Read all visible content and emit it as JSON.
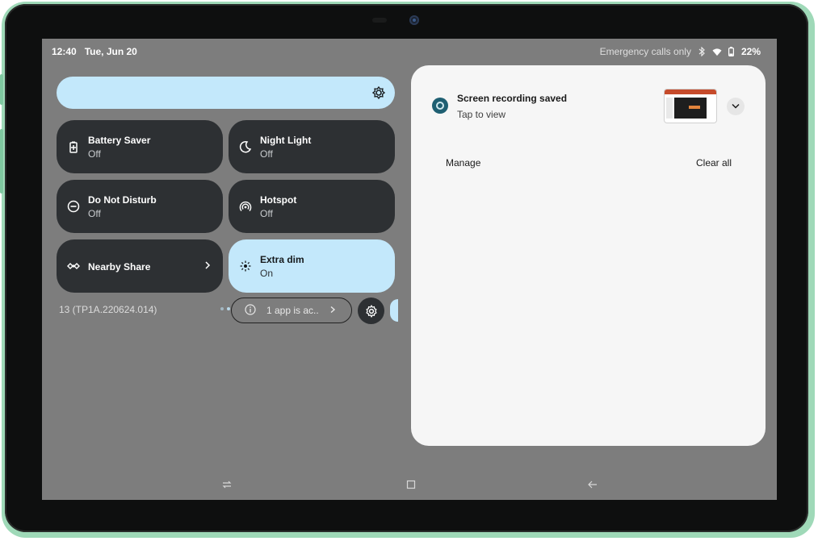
{
  "status_bar": {
    "time": "12:40",
    "date": "Tue, Jun 20",
    "carrier_text": "Emergency calls only",
    "battery": "22%"
  },
  "quick_settings": {
    "tiles": [
      {
        "title": "Battery Saver",
        "state": "Off",
        "icon": "battery-saver-icon",
        "active": false
      },
      {
        "title": "Night Light",
        "state": "Off",
        "icon": "night-light-icon",
        "active": false
      },
      {
        "title": "Do Not Disturb",
        "state": "Off",
        "icon": "do-not-disturb-icon",
        "active": false
      },
      {
        "title": "Hotspot",
        "state": "Off",
        "icon": "hotspot-icon",
        "active": false
      },
      {
        "title": "Nearby Share",
        "state": "",
        "icon": "nearby-share-icon",
        "active": false
      },
      {
        "title": "Extra dim",
        "state": "On",
        "icon": "extra-dim-icon",
        "active": true
      }
    ],
    "build_number": "13 (TP1A.220624.014)",
    "app_chip_text": "1 app is ac.."
  },
  "notifications": {
    "items": [
      {
        "title": "Screen recording saved",
        "subtitle": "Tap to view"
      }
    ],
    "manage_label": "Manage",
    "clear_all_label": "Clear all"
  },
  "colors": {
    "accent": "#c3e8fb",
    "tile_dark": "#2d3033",
    "scrim": "#7d7d7d",
    "panel": "#f6f6f6",
    "frame": "#9fd9b8"
  }
}
